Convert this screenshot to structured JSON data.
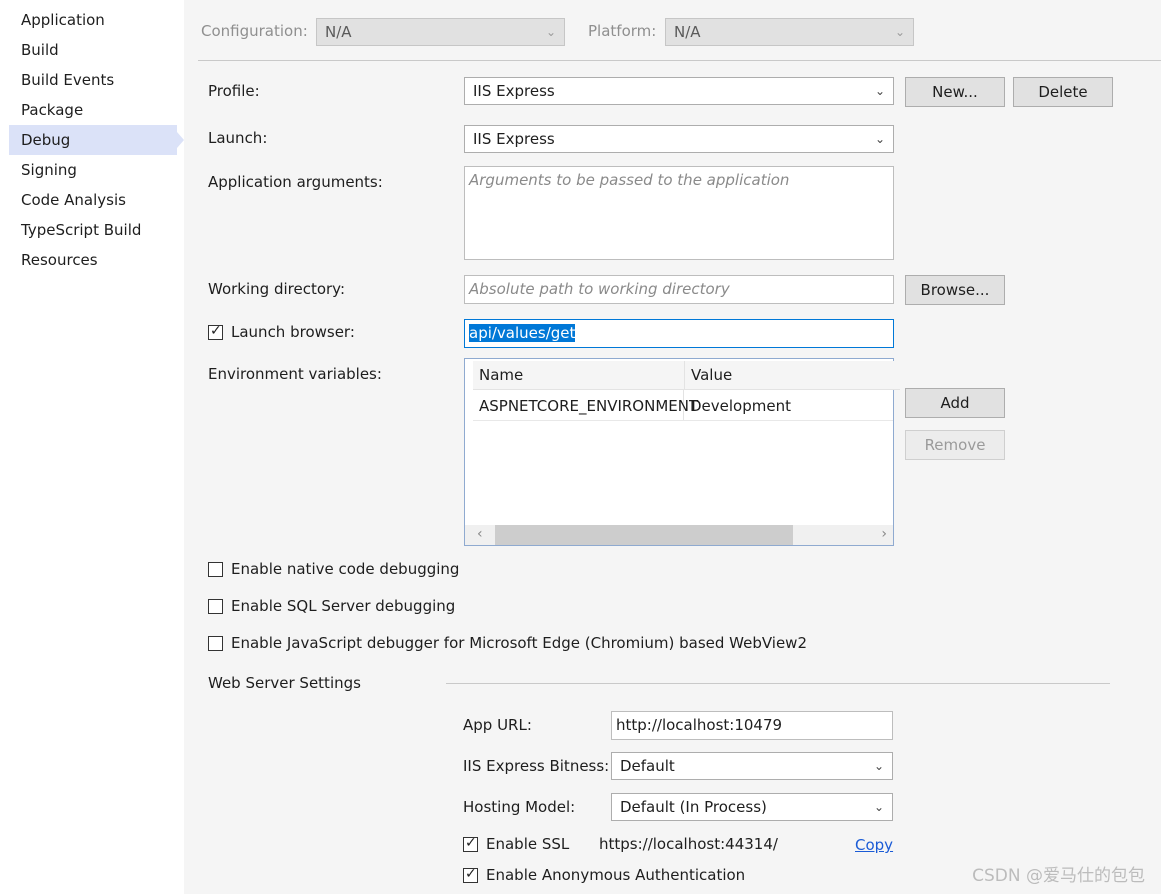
{
  "sidebar": {
    "items": [
      {
        "label": "Application"
      },
      {
        "label": "Build"
      },
      {
        "label": "Build Events"
      },
      {
        "label": "Package"
      },
      {
        "label": "Debug"
      },
      {
        "label": "Signing"
      },
      {
        "label": "Code Analysis"
      },
      {
        "label": "TypeScript Build"
      },
      {
        "label": "Resources"
      }
    ],
    "selected": "Debug"
  },
  "toolbar": {
    "configuration_label": "Configuration:",
    "configuration_value": "N/A",
    "platform_label": "Platform:",
    "platform_value": "N/A"
  },
  "profile": {
    "label": "Profile:",
    "value": "IIS Express",
    "new_button": "New...",
    "delete_button": "Delete"
  },
  "launch": {
    "label": "Launch:",
    "value": "IIS Express"
  },
  "app_args": {
    "label": "Application arguments:",
    "placeholder": "Arguments to be passed to the application"
  },
  "working_dir": {
    "label": "Working directory:",
    "placeholder": "Absolute path to working directory",
    "browse_button": "Browse..."
  },
  "launch_browser": {
    "label": "Launch browser:",
    "checked": true,
    "value": "api/values/get"
  },
  "env_vars": {
    "label": "Environment variables:",
    "columns": [
      "Name",
      "Value"
    ],
    "rows": [
      {
        "name": "ASPNETCORE_ENVIRONMENT",
        "value": "Development"
      }
    ],
    "add_button": "Add",
    "remove_button": "Remove"
  },
  "options": {
    "native_debugging": {
      "label": "Enable native code debugging",
      "checked": false
    },
    "sql_debugging": {
      "label": "Enable SQL Server debugging",
      "checked": false
    },
    "js_debugging": {
      "label": "Enable JavaScript debugger for Microsoft Edge (Chromium) based WebView2",
      "checked": false
    }
  },
  "web_server": {
    "section_title": "Web Server Settings",
    "app_url_label": "App URL:",
    "app_url_value": "http://localhost:10479",
    "bitness_label": "IIS Express Bitness:",
    "bitness_value": "Default",
    "hosting_label": "Hosting Model:",
    "hosting_value": "Default (In Process)",
    "ssl_label": "Enable SSL",
    "ssl_checked": true,
    "ssl_url": "https://localhost:44314/",
    "copy_link": "Copy",
    "anon_auth_label": "Enable Anonymous Authentication",
    "anon_auth_checked": true
  },
  "watermark": "CSDN @爱马仕的包包"
}
